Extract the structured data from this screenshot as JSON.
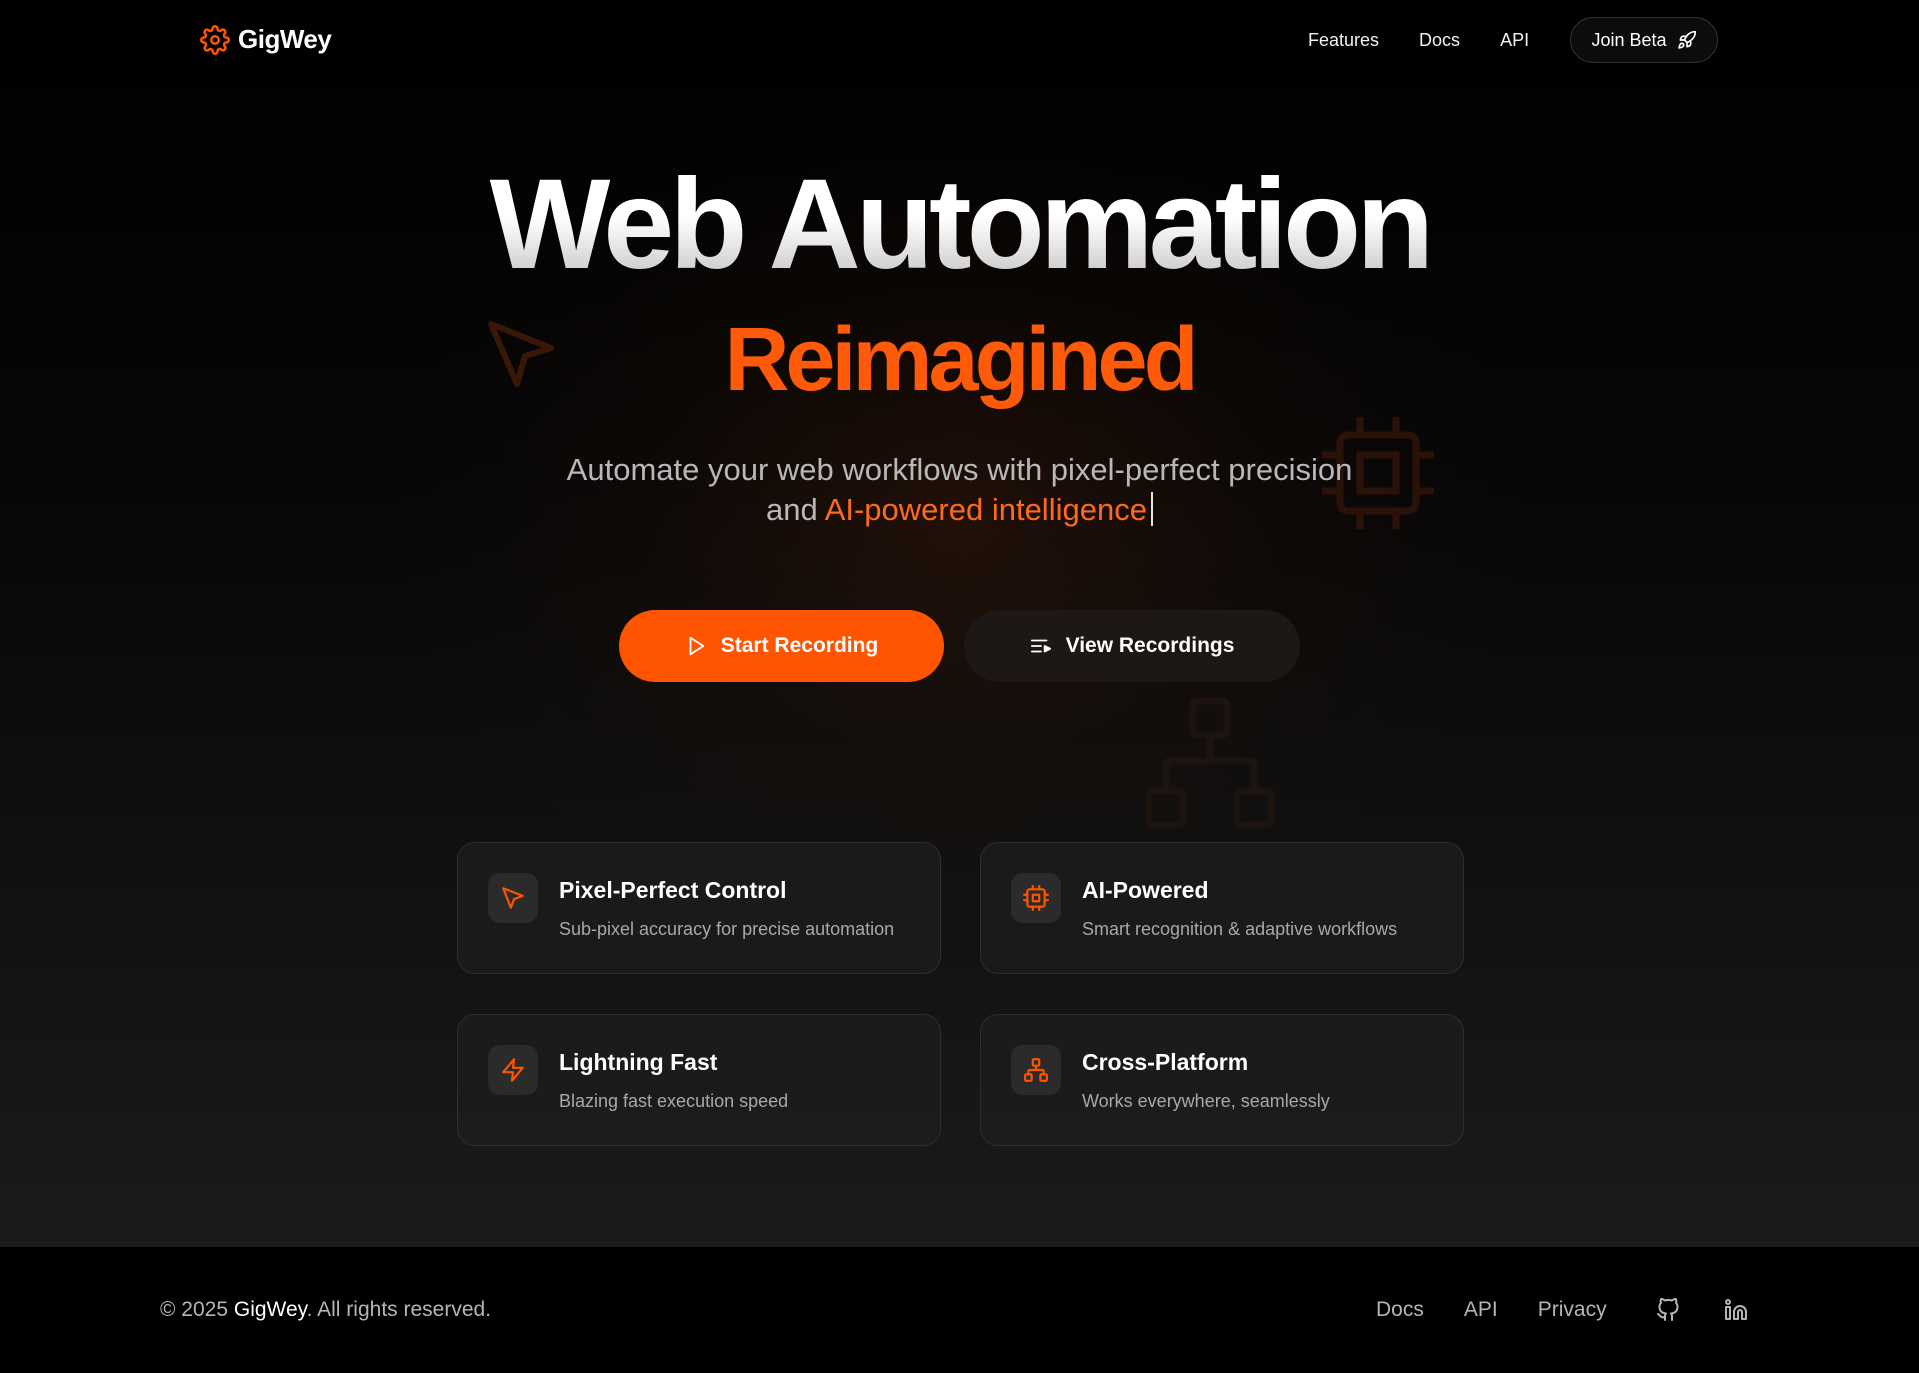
{
  "colors": {
    "accent": "#ff5500",
    "background": "#000000",
    "card_bg": "#1e1e1e",
    "muted_text": "#a8a8a8"
  },
  "nav": {
    "brand": {
      "name": "GigWey",
      "icon": "gear-icon"
    },
    "links": [
      {
        "label": "Features"
      },
      {
        "label": "Docs"
      },
      {
        "label": "API"
      }
    ],
    "cta": {
      "label": "Join Beta",
      "icon": "rocket-icon"
    }
  },
  "hero": {
    "title": "Web Automation",
    "title_accent": "Reimagined",
    "subtitle_line1": "Automate your web workflows with pixel-perfect precision",
    "subtitle_line2_prefix": "and",
    "subtitle_line2_accent": "AI-powered intelligence",
    "primary_button": {
      "label": "Start Recording",
      "icon": "play-icon"
    },
    "secondary_button": {
      "label": "View Recordings",
      "icon": "list-play-icon"
    }
  },
  "features": [
    {
      "title": "Pixel-Perfect Control",
      "description": "Sub-pixel accuracy for precise automation",
      "icon": "cursor-icon"
    },
    {
      "title": "AI-Powered",
      "description": "Smart recognition & adaptive workflows",
      "icon": "cpu-icon"
    },
    {
      "title": "Lightning Fast",
      "description": "Blazing fast execution speed",
      "icon": "lightning-icon"
    },
    {
      "title": "Cross-Platform",
      "description": "Works everywhere, seamlessly",
      "icon": "network-icon"
    }
  ],
  "footer": {
    "copyright_prefix": "© 2025",
    "copyright_brand": "GigWey",
    "copyright_suffix": ". All rights reserved.",
    "links": [
      {
        "label": "Docs"
      },
      {
        "label": "API"
      },
      {
        "label": "Privacy"
      }
    ],
    "social": [
      {
        "name": "github-icon"
      },
      {
        "name": "linkedin-icon"
      }
    ]
  }
}
